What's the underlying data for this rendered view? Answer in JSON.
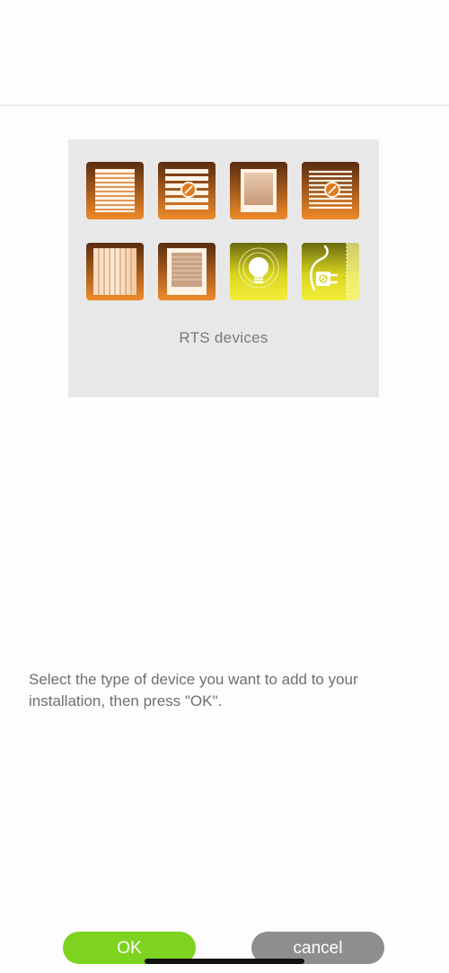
{
  "device_card": {
    "label": "RTS devices",
    "icons": [
      "roller-shutter-icon",
      "exterior-venetian-blind-icon",
      "window-covering-icon",
      "venetian-blind-icon",
      "curtain-icon",
      "interior-blind-icon",
      "light-icon",
      "plug-icon"
    ]
  },
  "instructions": "Select the type of device you want to add to your installation, then press \"OK\".",
  "buttons": {
    "ok_label": "OK",
    "cancel_label": "cancel"
  },
  "colors": {
    "ok": "#7ed321",
    "cancel": "#8e8e8e",
    "orange_tile": "#e07a1f",
    "yellow_tile": "#e8e02a",
    "card_bg": "#e8e8e8"
  }
}
